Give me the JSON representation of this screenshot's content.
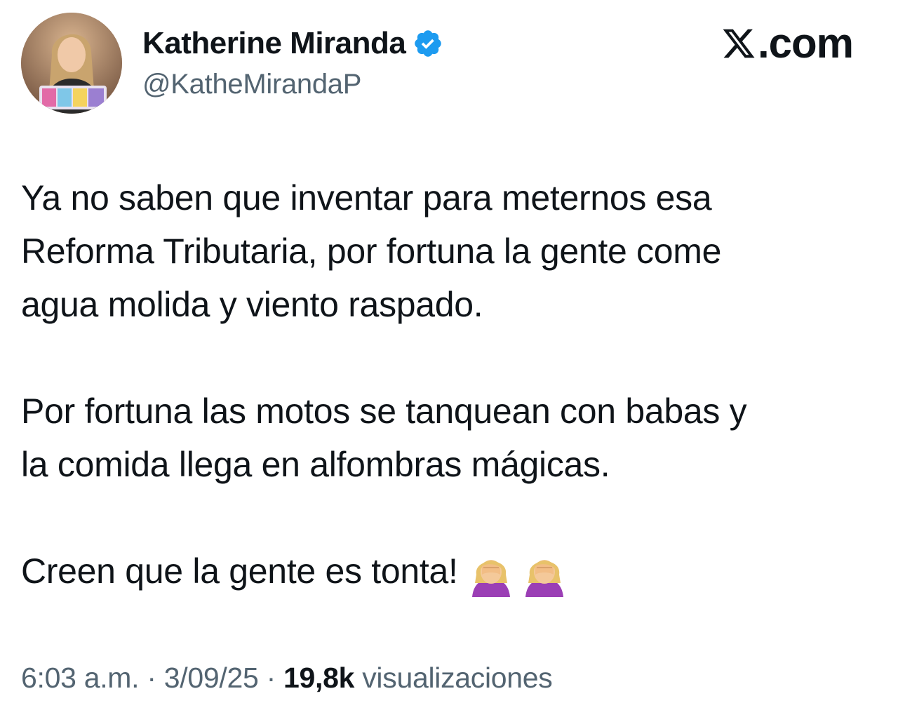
{
  "author": {
    "display_name": "Katherine Miranda",
    "handle": "@KatheMirandaP",
    "verified": true,
    "avatar_icon": "profile-photo"
  },
  "brand": {
    "site": ".com",
    "logo_icon": "x-logo-icon"
  },
  "tweet": {
    "paragraphs": [
      [
        "Ya no saben que inventar para meternos esa",
        "Reforma Tributaria, por fortuna la gente come",
        "agua molida y viento raspado."
      ],
      [
        "Por fortuna las motos se tanquean con babas y",
        "la comida llega en alfombras mágicas."
      ],
      [
        "Creen que la gente es tonta!"
      ]
    ],
    "emojis": [
      "woman-facepalming-emoji",
      "woman-facepalming-emoji"
    ]
  },
  "meta": {
    "time": "6:03 a.m.",
    "separator": "·",
    "date": "3/09/25",
    "views_count": "19,8k",
    "views_label": "visualizaciones"
  },
  "colors": {
    "text_primary": "#0f1419",
    "text_secondary": "#536471",
    "verified_blue": "#1d9bf0"
  }
}
